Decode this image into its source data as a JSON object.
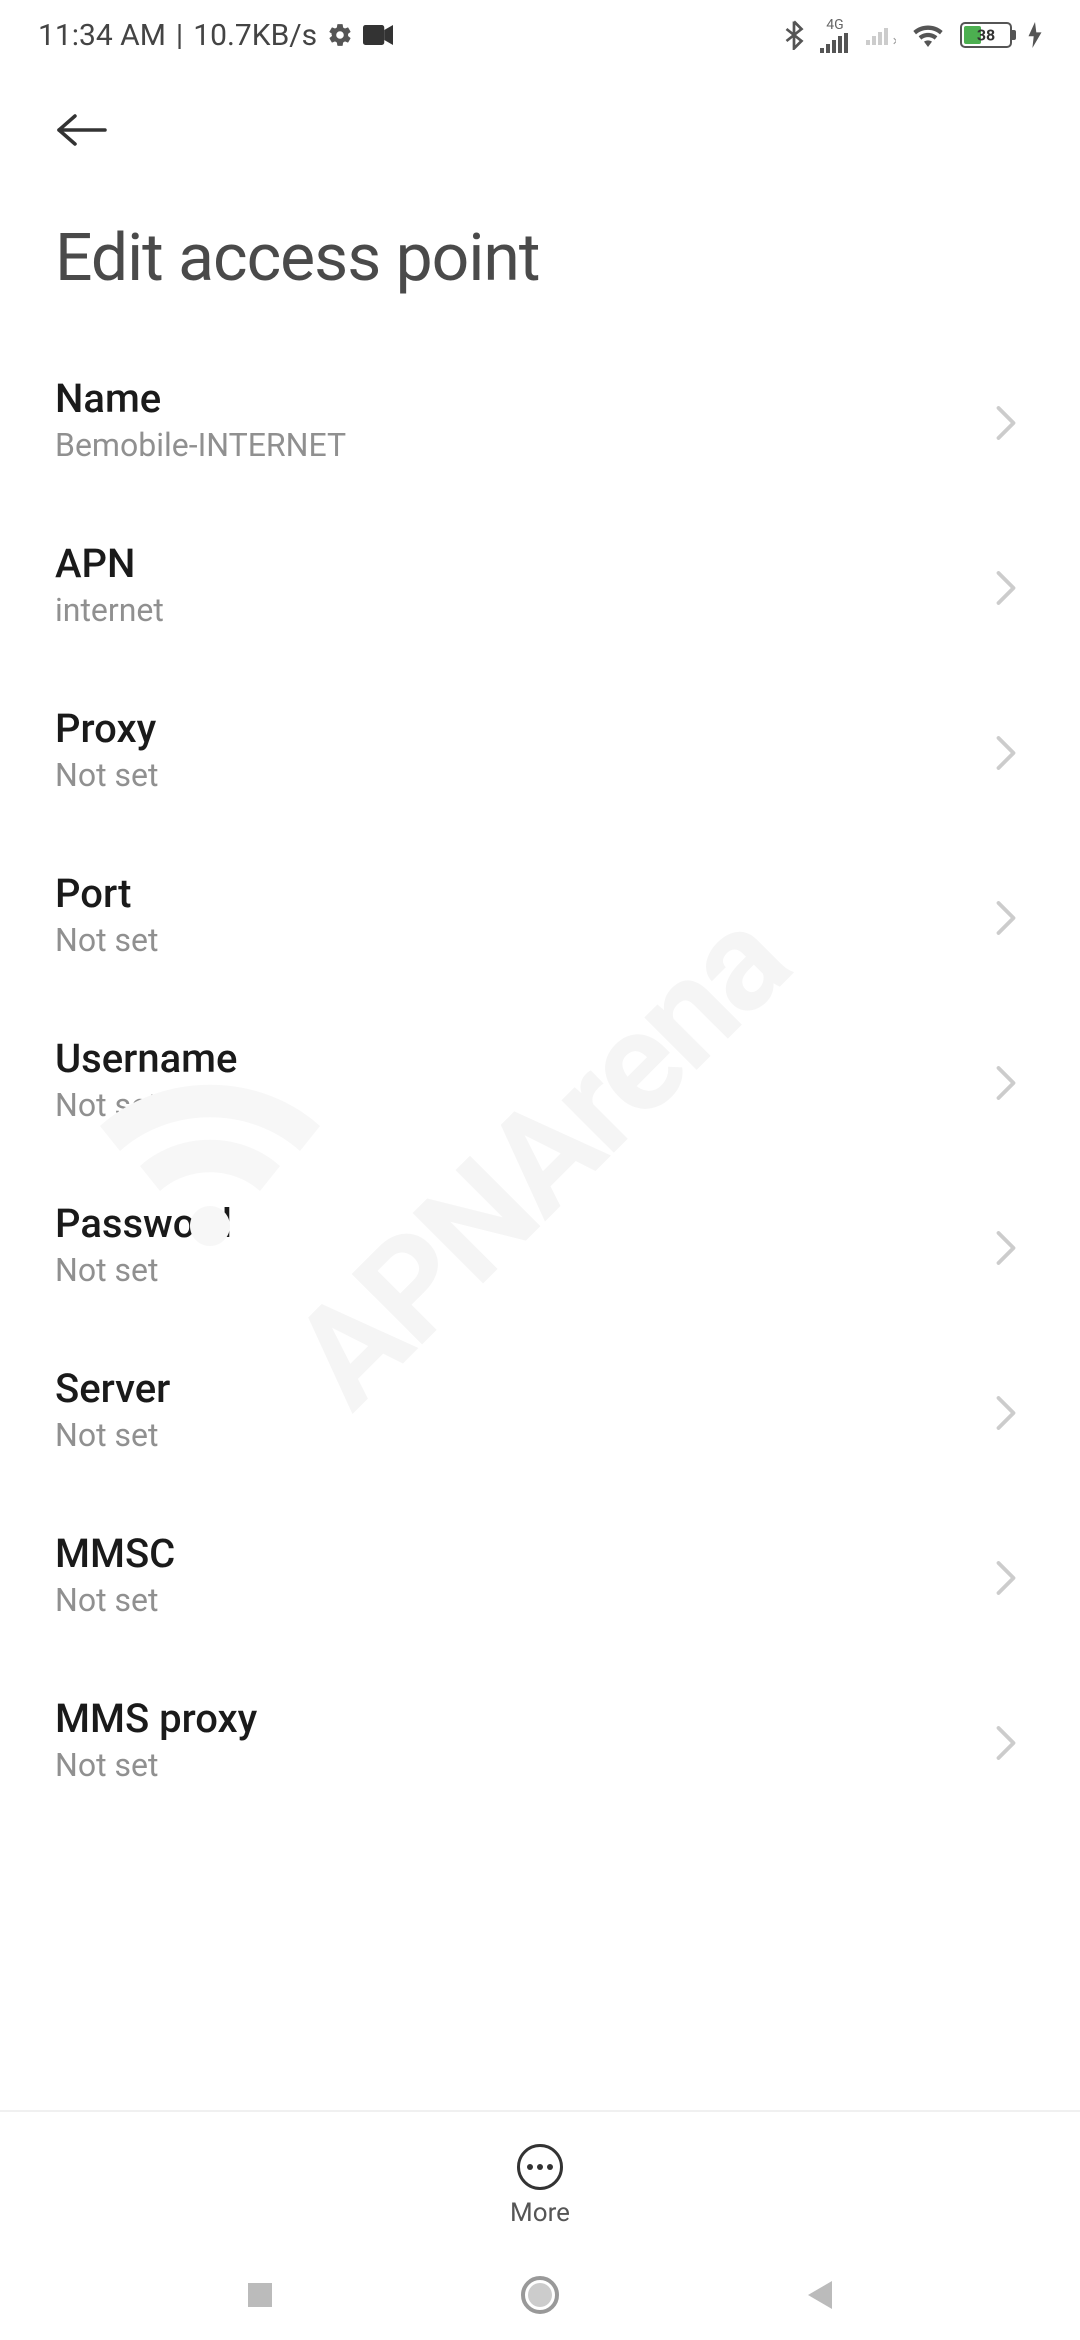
{
  "status_bar": {
    "time": "11:34 AM",
    "data_speed": "10.7KB/s",
    "battery_percent": "38",
    "network_label": "4G"
  },
  "page_title": "Edit access point",
  "settings": [
    {
      "label": "Name",
      "value": "Bemobile-INTERNET"
    },
    {
      "label": "APN",
      "value": "internet"
    },
    {
      "label": "Proxy",
      "value": "Not set"
    },
    {
      "label": "Port",
      "value": "Not set"
    },
    {
      "label": "Username",
      "value": "Not set"
    },
    {
      "label": "Password",
      "value": "Not set"
    },
    {
      "label": "Server",
      "value": "Not set"
    },
    {
      "label": "MMSC",
      "value": "Not set"
    },
    {
      "label": "MMS proxy",
      "value": "Not set"
    }
  ],
  "bottom_bar": {
    "more_label": "More"
  },
  "watermark": "APNArena"
}
